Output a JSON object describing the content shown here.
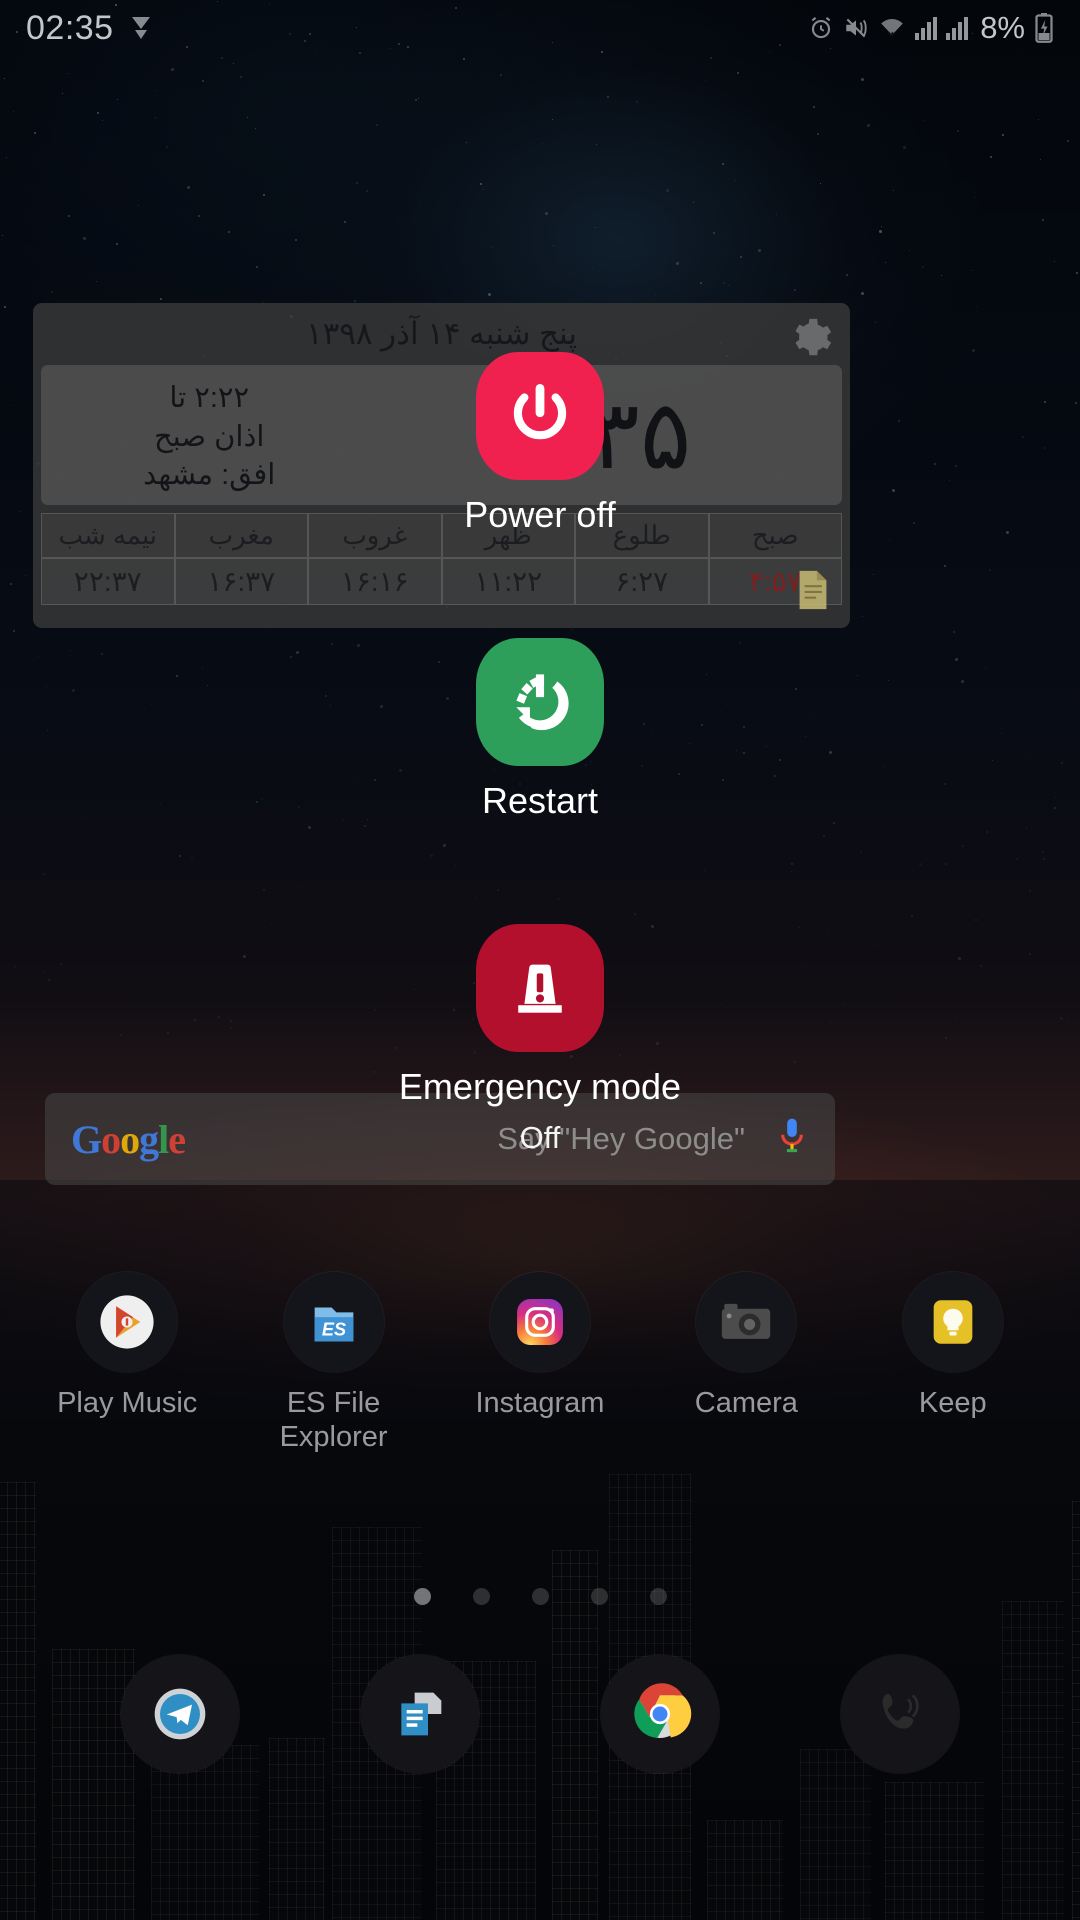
{
  "status_bar": {
    "clock": "02:35",
    "battery_percent": "8%",
    "left_icons": [
      "play-triangle-icon"
    ],
    "right_icons": [
      "alarm-icon",
      "mute-vibrate-icon",
      "wifi-icon",
      "signal-bars-sim1-icon",
      "signal-bars-sim2-icon",
      "battery-charging-icon"
    ]
  },
  "widget": {
    "date": "پنج شنبه ۱۴ آذر ۱۳۹۸",
    "countdown": "۲:۲۲ تا",
    "event": "اذان صبح",
    "location": "افق: مشهد",
    "clock": "۲:۳۵",
    "gear_icon": "gear-icon",
    "note_icon": "note-icon",
    "table": {
      "headers": [
        "نیمه شب",
        "مغرب",
        "غروب",
        "ظهر",
        "طلوع",
        "صبح"
      ],
      "times": [
        "۲۲:۳۷",
        "۱۶:۳۷",
        "۱۶:۱۶",
        "۱۱:۲۲",
        "۶:۲۷",
        "۴:۵۷"
      ],
      "alert_index": 5,
      "alert_color": "#7e1f1f"
    }
  },
  "search_bar": {
    "logo": "Google",
    "logo_letters": [
      {
        "ch": "G",
        "color": "#4285F4"
      },
      {
        "ch": "o",
        "color": "#EA4335"
      },
      {
        "ch": "o",
        "color": "#FBBC05"
      },
      {
        "ch": "g",
        "color": "#4285F4"
      },
      {
        "ch": "l",
        "color": "#34A853"
      },
      {
        "ch": "e",
        "color": "#EA4335"
      }
    ],
    "placeholder": "Say \"Hey Google\"",
    "mic_icon": "microphone-icon"
  },
  "apps": [
    {
      "label": "Play Music",
      "icon": "play-music-icon"
    },
    {
      "label": "ES File Explorer",
      "icon": "es-file-explorer-icon"
    },
    {
      "label": "Instagram",
      "icon": "instagram-icon"
    },
    {
      "label": "Camera",
      "icon": "camera-icon"
    },
    {
      "label": "Keep",
      "icon": "google-keep-icon"
    }
  ],
  "page_dots": {
    "count": 5,
    "active_index": 0
  },
  "dock": [
    {
      "label": "Telegram",
      "icon": "telegram-icon"
    },
    {
      "label": "Messages",
      "icon": "messages-icon"
    },
    {
      "label": "Chrome",
      "icon": "chrome-icon"
    },
    {
      "label": "Phone",
      "icon": "phone-icon"
    }
  ],
  "power_menu": {
    "power_off": {
      "label": "Power off",
      "icon": "power-icon",
      "color": "#F0204F"
    },
    "restart": {
      "label": "Restart",
      "icon": "restart-icon",
      "color": "#2E9E5B"
    },
    "emergency": {
      "label": "Emergency mode",
      "status": "Off",
      "icon": "emergency-beacon-icon",
      "color": "#B3102E"
    }
  }
}
